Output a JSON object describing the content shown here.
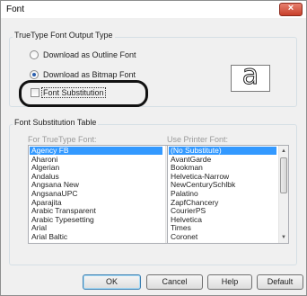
{
  "window": {
    "title": "Font",
    "close_glyph": "×"
  },
  "output_type": {
    "label": "TrueType Font Output Type",
    "options": [
      {
        "label": "Download as Outline Font",
        "checked": false
      },
      {
        "label": "Download as Bitmap Font",
        "checked": true
      }
    ],
    "preview_glyph": "a"
  },
  "font_substitution": {
    "label": "Font Substitution",
    "checked": false
  },
  "substitution_table": {
    "label": "Font Substitution Table",
    "truetype_column_label": "For TrueType Font:",
    "printer_column_label": "Use Printer Font:",
    "truetype_fonts": [
      "Agency FB",
      "Aharoni",
      "Algerian",
      "Andalus",
      "Angsana New",
      "AngsanaUPC",
      "Aparajita",
      "Arabic Transparent",
      "Arabic Typesetting",
      "Arial",
      "Arial Baltic"
    ],
    "printer_fonts": [
      "(No Substitute)",
      "AvantGarde",
      "Bookman",
      "Helvetica-Narrow",
      "NewCenturySchlbk",
      "Palatino",
      "ZapfChancery",
      "CourierPS",
      "Helvetica",
      "Times",
      "Coronet"
    ],
    "selected_index": 0
  },
  "buttons": {
    "ok": "OK",
    "cancel": "Cancel",
    "help": "Help",
    "default": "Default"
  },
  "colors": {
    "selection": "#3399ff",
    "highlight_ring": "#111111",
    "close_button": "#c8402b"
  }
}
